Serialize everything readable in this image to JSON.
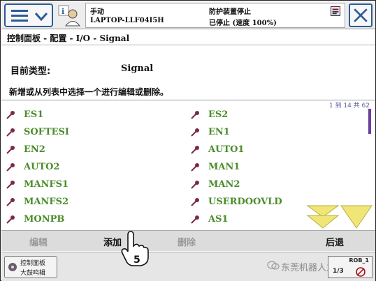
{
  "header": {
    "mode": "手动",
    "controller": "LAPTOP-LLF04I5H",
    "status_line1": "防护装置停止",
    "status_line2": "已停止 (速度 100%)"
  },
  "breadcrumb": "控制面板 - 配置 - I/O - Signal",
  "current_type": {
    "label": "目前类型:",
    "value": "Signal"
  },
  "instruction": "新增或从列表中选择一个进行编辑或删除。",
  "list": {
    "range_text": "1 到 14 共 62",
    "left_items": [
      "ES1",
      "SOFTESI",
      "EN2",
      "AUTO2",
      "MANFS1",
      "MANFS2",
      "MONPB"
    ],
    "right_items": [
      "ES2",
      "EN1",
      "AUTO1",
      "MAN1",
      "MAN2",
      "USERDOOVLD",
      "AS1"
    ]
  },
  "actions": {
    "edit": "编辑",
    "add": "添加",
    "delete": "删除",
    "back": "后退"
  },
  "step_number": "5",
  "taskbar": {
    "item_label": "控制面板",
    "item_label2": "大鼓鸣辑",
    "rob_label": "ROB_1",
    "rob_fraction": "1/3",
    "watermark": "东莞机器人之家"
  },
  "colors": {
    "item_text": "#4a8c2a",
    "key_icon": "#7a2a4a",
    "page_arrows": "#f0e678",
    "accent": "#2c5b9a"
  }
}
